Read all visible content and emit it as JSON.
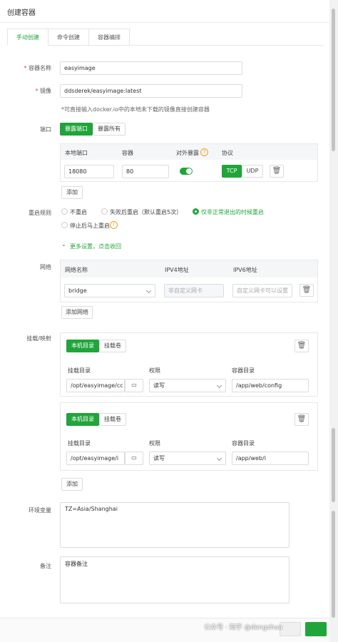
{
  "dialog": {
    "title": "创建容器"
  },
  "tabs": [
    {
      "label": "手动创建"
    },
    {
      "label": "命令创建"
    },
    {
      "label": "容器编排"
    }
  ],
  "form": {
    "name": {
      "label": "容器名称",
      "value": "easyimage"
    },
    "image": {
      "label": "镜像",
      "value": "ddsderek/easyimage:latest",
      "hint": "*可直接输入docker.io中的本地未下载的镜像直接创建容器"
    },
    "port": {
      "label": "端口",
      "modes": [
        "暴露端口",
        "暴露所有"
      ],
      "headers": [
        "本地端口",
        "容器",
        "对外暴露",
        "协议"
      ],
      "row": {
        "local": "18080",
        "container": "80",
        "exposed": true,
        "protocols": [
          "TCP",
          "UDP"
        ]
      },
      "add": "添加"
    },
    "restart": {
      "label": "重启规则",
      "options": [
        "不重启",
        "失败后重启（默认重启5次）",
        "仅非正常退出的时候重启",
        "停止后马上重启"
      ],
      "selected": 2
    },
    "more": "更多设置，点击收回",
    "network": {
      "label": "网络",
      "headers": [
        "网络名称",
        "IPV4地址",
        "IPV6地址"
      ],
      "row": {
        "name": "bridge",
        "ipv4_placeholder": "非自定义网卡",
        "ipv6_placeholder": "自定义网卡可以设置"
      },
      "add": "添加网络"
    },
    "mount": {
      "label": "挂载/映射",
      "modes": [
        "本机目录",
        "挂载卷"
      ],
      "headers": [
        "挂载目录",
        "权限",
        "容器目录"
      ],
      "rows": [
        {
          "host": "/opt/easyimage/cc",
          "perm": "读写",
          "container": "/app/web/config"
        },
        {
          "host": "/opt/easyimage/i",
          "perm": "读写",
          "container": "/app/web/i"
        }
      ],
      "add": "添加"
    },
    "env": {
      "label": "环境变量",
      "value": "TZ=Asia/Shanghai"
    },
    "remark": {
      "label": "备注",
      "placeholder": "容器备注"
    }
  },
  "watermark": "公众号 · 知乎 @dengshua",
  "colors": {
    "accent": "#20a53a",
    "required": "#e03e3e",
    "warning": "#f0a020"
  }
}
